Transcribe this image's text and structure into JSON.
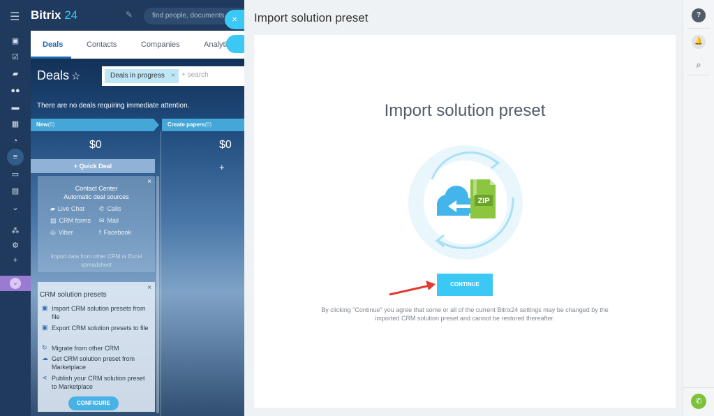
{
  "app": {
    "logo_name": "Bitrix",
    "logo_num": "24",
    "search_placeholder": "find people, documents, a"
  },
  "sidebar_icons": [
    "menu-icon",
    "feed-icon",
    "tasks-icon",
    "chat-icon",
    "employees-icon",
    "drive-icon",
    "calendar-icon",
    "clock-icon",
    "crm-icon",
    "sites-icon",
    "contact-center-icon",
    "more-icon",
    "sitemap-icon",
    "settings-icon",
    "add-icon",
    "apps-icon"
  ],
  "crm": {
    "tabs": [
      "Deals",
      "Contacts",
      "Companies",
      "Analyti"
    ],
    "title": "Deals",
    "filter_chip": "Deals in progress",
    "filter_chip_remove": "×",
    "filter_placeholder": "+ search",
    "notice": "There are no deals requiring immediate attention.",
    "stages": [
      {
        "name": "New",
        "count": "(0)",
        "amount": "$0"
      },
      {
        "name": "Create papers",
        "count": "(0)",
        "amount": "$0"
      }
    ],
    "quick_deal": "+ Quick Deal",
    "add_plus": "+"
  },
  "contact_center": {
    "title": "Contact Center",
    "subtitle": "Automatic deal sources",
    "sources": [
      "Live Chat",
      "Calls",
      "CRM forms",
      "Mail",
      "Viber",
      "Facebook"
    ],
    "import_text": "Import data from other CRM or Excel spreadsheet",
    "close": "×"
  },
  "solution_presets": {
    "title": "CRM solution presets",
    "items": [
      "Import CRM solution presets from file",
      "Export CRM solution presets to file",
      "Migrate from other CRM",
      "Get CRM solution preset from Marketplace",
      "Publish your CRM solution preset to Marketplace"
    ],
    "configure": "CONFIGURE",
    "close": "×"
  },
  "slider": {
    "close": "×",
    "page_title": "Import solution preset",
    "card_title": "Import solution preset",
    "zip_label": "ZIP",
    "continue": "CONTINUE",
    "disclaimer": "By clicking \"Continue\" you agree that some or all of the current Bitrix24 settings may be changed by the imported CRM solution preset and cannot be restored thereafter."
  },
  "right_rail": {
    "help": "?",
    "bell": "🔔",
    "search": "⌕",
    "phone": "✆"
  },
  "colors": {
    "accent": "#3bc8f5",
    "sidebar": "#1f3a5c",
    "zip_green": "#8cc63f",
    "cloud_blue": "#43b5ea",
    "arrow_red": "#e03c31"
  }
}
